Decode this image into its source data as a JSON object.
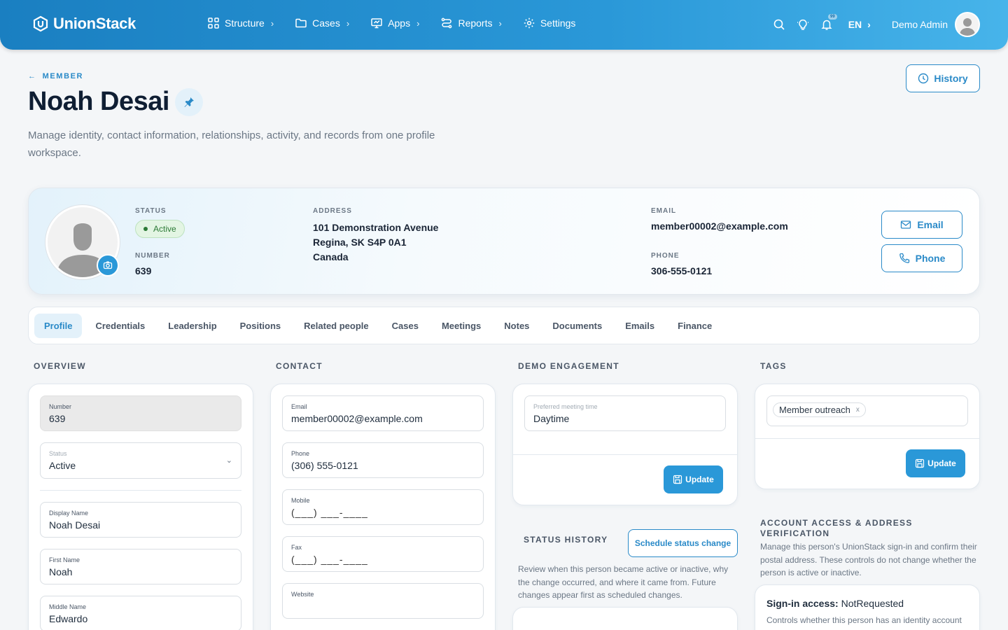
{
  "app": {
    "brand": "UnionStack"
  },
  "nav": [
    {
      "label": "Structure",
      "icon": "grid-icon"
    },
    {
      "label": "Cases",
      "icon": "folder-icon"
    },
    {
      "label": "Apps",
      "icon": "monitor-icon"
    },
    {
      "label": "Reports",
      "icon": "route-icon"
    },
    {
      "label": "Settings",
      "icon": "gear-icon"
    }
  ],
  "topbar": {
    "language": "EN",
    "user_name": "Demo Admin",
    "notification_badge": "99"
  },
  "header": {
    "breadcrumb": "MEMBER",
    "title": "Noah Desai",
    "subtitle": "Manage identity, contact information, relationships, activity, and records from one profile workspace.",
    "history_label": "History"
  },
  "profile": {
    "status_label": "STATUS",
    "status_value": "Active",
    "number_label": "NUMBER",
    "number_value": "639",
    "address_label": "ADDRESS",
    "address_lines": [
      "101 Demonstration Avenue",
      "Regina, SK S4P 0A1",
      "Canada"
    ],
    "email_label": "EMAIL",
    "email_value": "member00002@example.com",
    "phone_label": "PHONE",
    "phone_value": "306-555-0121",
    "email_button": "Email",
    "phone_button": "Phone"
  },
  "tabs": [
    "Profile",
    "Credentials",
    "Leadership",
    "Positions",
    "Related people",
    "Cases",
    "Meetings",
    "Notes",
    "Documents",
    "Emails",
    "Finance"
  ],
  "active_tab": "Profile",
  "overview": {
    "title": "OVERVIEW",
    "number_label": "Number",
    "number_value": "639",
    "status_label": "Status",
    "status_value": "Active",
    "display_name_label": "Display Name",
    "display_name_value": "Noah Desai",
    "first_name_label": "First Name",
    "first_name_value": "Noah",
    "middle_name_label": "Middle Name",
    "middle_name_value": "Edwardo"
  },
  "contact": {
    "title": "CONTACT",
    "email_label": "Email",
    "email_value": "member00002@example.com",
    "phone_label": "Phone",
    "phone_value": "(306) 555-0121",
    "mobile_label": "Mobile",
    "mobile_value": "(___) ___-____",
    "fax_label": "Fax",
    "fax_value": "(___) ___-____",
    "website_label": "Website",
    "website_value": ""
  },
  "engagement": {
    "title": "DEMO ENGAGEMENT",
    "meeting_label": "Preferred meeting time",
    "meeting_value": "Daytime",
    "update_label": "Update"
  },
  "status_history": {
    "title": "STATUS HISTORY",
    "schedule_button": "Schedule status change",
    "description": "Review when this person became active or inactive, why the change occurred, and where it came from. Future changes appear first as scheduled changes."
  },
  "tags": {
    "title": "TAGS",
    "items": [
      "Member outreach"
    ],
    "remove_glyph": "x",
    "update_label": "Update"
  },
  "account": {
    "title": "ACCOUNT ACCESS & ADDRESS VERIFICATION",
    "description": "Manage this person's UnionStack sign-in and confirm their postal address. These controls do not change whether the person is active or inactive.",
    "signin_label": "Sign-in access:",
    "signin_value": "NotRequested",
    "signin_description": "Controls whether this person has an identity account"
  },
  "colors": {
    "accent": "#2a98d8",
    "brand_dark": "#1a7fc1",
    "active_green": "#2c7a36"
  }
}
